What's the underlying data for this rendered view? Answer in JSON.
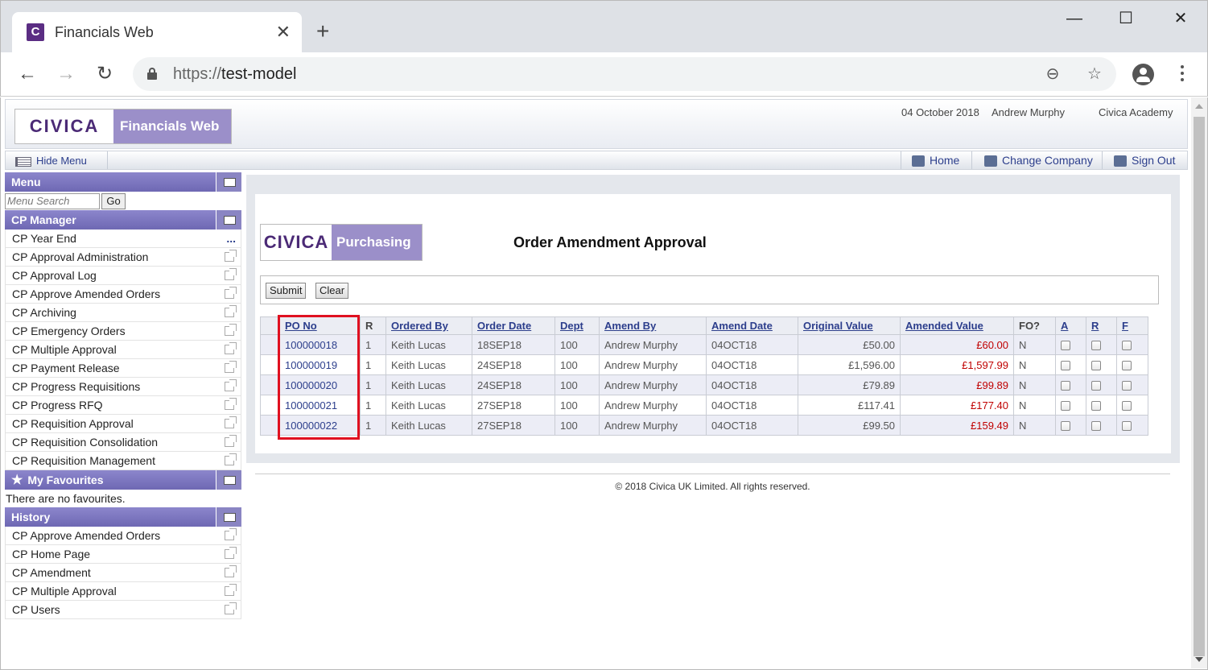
{
  "browser": {
    "tab_title": "Financials Web",
    "tab_favicon": "C",
    "url_scheme": "https://",
    "url_host": "test-model",
    "new_tab": "+",
    "close_tab": "✕",
    "minimize": "—",
    "maximize": "☐",
    "close_window": "✕"
  },
  "header": {
    "logo_brand": "CIVICA",
    "logo_product": "Financials Web",
    "date": "04 October 2018",
    "user": "Andrew Murphy",
    "company": "Civica Academy"
  },
  "subbar": {
    "hide_menu": "Hide Menu",
    "home": "Home",
    "change_company": "Change Company",
    "sign_out": "Sign Out"
  },
  "menu": {
    "title": "Menu",
    "search_placeholder": "Menu Search",
    "go_label": "Go"
  },
  "cp_manager": {
    "title": "CP Manager",
    "items": [
      "CP Year End",
      "CP Approval Administration",
      "CP Approval Log",
      "CP Approve Amended Orders",
      "CP Archiving",
      "CP Emergency Orders",
      "CP Multiple Approval",
      "CP Payment Release",
      "CP Progress Requisitions",
      "CP Progress RFQ",
      "CP Requisition Approval",
      "CP Requisition Consolidation",
      "CP Requisition Management"
    ],
    "more": "..."
  },
  "favourites": {
    "title": "My Favourites",
    "empty_text": "There are no favourites."
  },
  "history": {
    "title": "History",
    "items": [
      "CP Approve Amended Orders",
      "CP Home Page",
      "CP Amendment",
      "CP Multiple Approval",
      "CP Users"
    ]
  },
  "main": {
    "logo_brand": "CIVICA",
    "logo_product": "Purchasing",
    "title": "Order Amendment Approval",
    "submit_label": "Submit",
    "clear_label": "Clear"
  },
  "table": {
    "headers": [
      "PO No",
      "R",
      "Ordered By",
      "Order Date",
      "Dept",
      "Amend By",
      "Amend Date",
      "Original Value",
      "Amended Value",
      "FO?",
      "A",
      "R",
      "F"
    ],
    "rows": [
      [
        "100000018",
        "1",
        "Keith Lucas",
        "18SEP18",
        "100",
        "Andrew Murphy",
        "04OCT18",
        "£50.00",
        "£60.00",
        "N"
      ],
      [
        "100000019",
        "1",
        "Keith Lucas",
        "24SEP18",
        "100",
        "Andrew Murphy",
        "04OCT18",
        "£1,596.00",
        "£1,597.99",
        "N"
      ],
      [
        "100000020",
        "1",
        "Keith Lucas",
        "24SEP18",
        "100",
        "Andrew Murphy",
        "04OCT18",
        "£79.89",
        "£99.89",
        "N"
      ],
      [
        "100000021",
        "1",
        "Keith Lucas",
        "27SEP18",
        "100",
        "Andrew Murphy",
        "04OCT18",
        "£117.41",
        "£177.40",
        "N"
      ],
      [
        "100000022",
        "1",
        "Keith Lucas",
        "27SEP18",
        "100",
        "Andrew Murphy",
        "04OCT18",
        "£99.50",
        "£159.49",
        "N"
      ]
    ]
  },
  "footer": {
    "copyright": "© 2018 Civica UK Limited. All rights reserved."
  },
  "colors": {
    "accent": "#6e68b3",
    "link": "#2c3e8c",
    "amended_value": "#c00000",
    "highlight": "#e01020"
  }
}
